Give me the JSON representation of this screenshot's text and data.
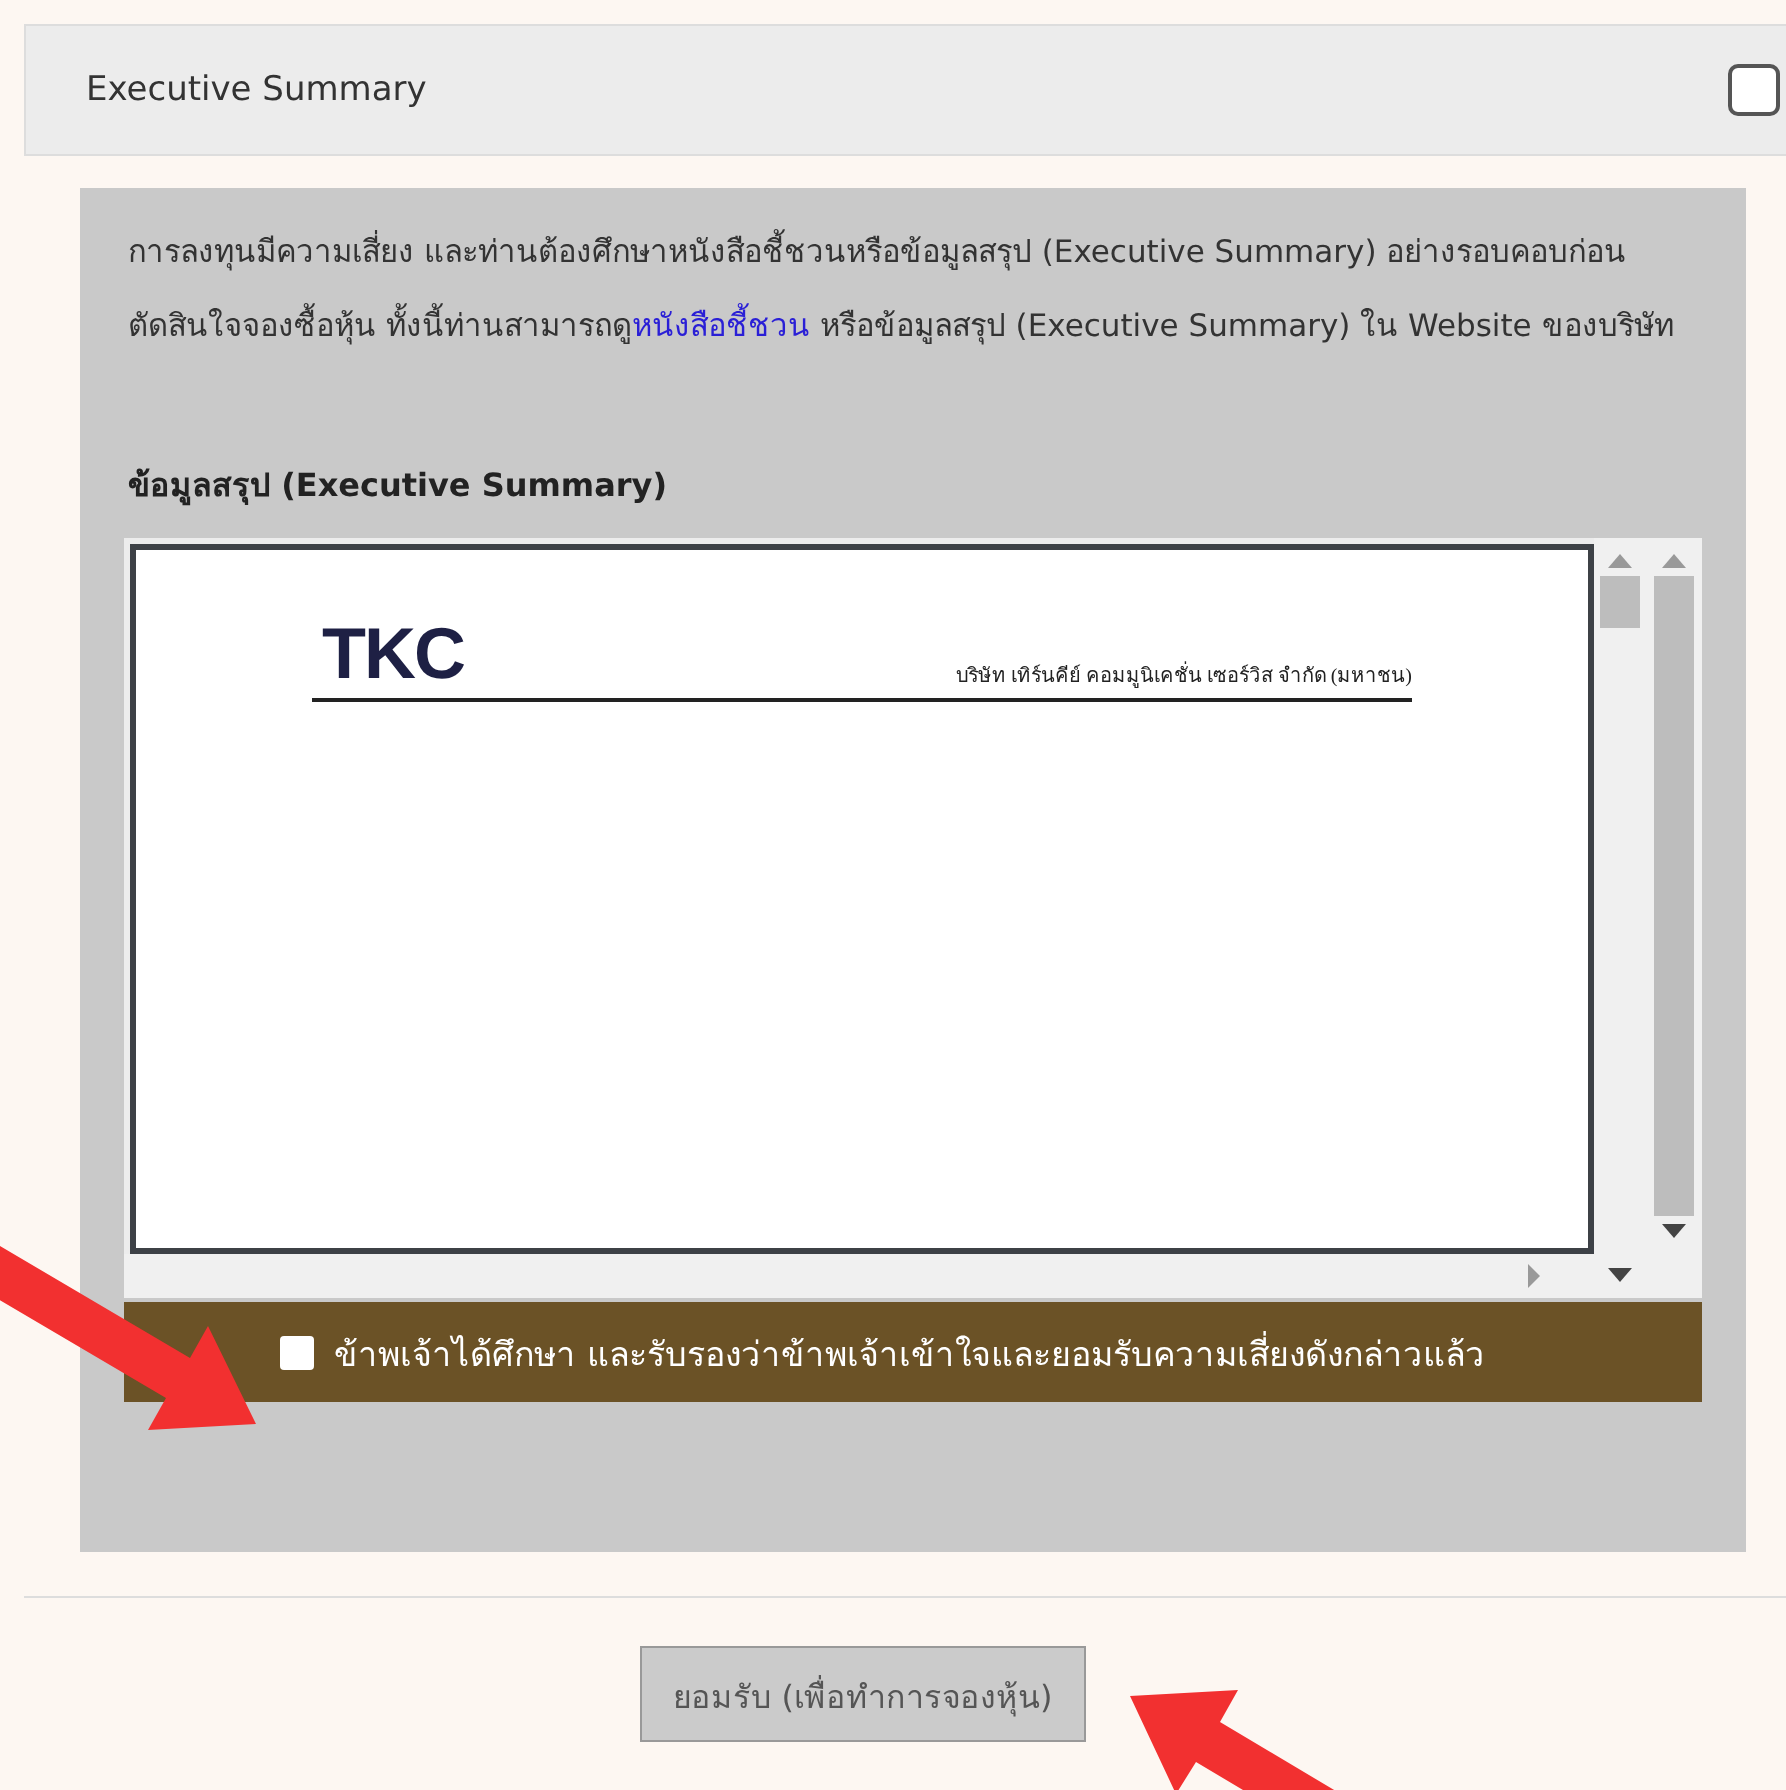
{
  "header": {
    "title": "Executive Summary",
    "checked": false
  },
  "intro": {
    "before": "การลงทุนมีความเสี่ยง และท่านต้องศึกษาหนังสือชี้ชวนหรือข้อมูลสรุป (Executive Summary) อย่างรอบคอบก่อนตัดสินใจจองซื้อหุ้น ทั้งนี้ท่านสามารถดู",
    "link": "หนังสือชี้ชวน",
    "after": " หรือข้อมูลสรุป (Executive Summary) ใน Website ของบริษัท"
  },
  "section_title": "ข้อมูลสรุป (Executive Summary)",
  "document": {
    "logo": "TKC",
    "company": "บริษัท เทิร์นคีย์ คอมมูนิเคชั่น เซอร์วิส จำกัด (มหาชน)"
  },
  "consent": {
    "label": "ข้าพเจ้าได้ศึกษา และรับรองว่าข้าพเจ้าเข้าใจและยอมรับความเสี่ยงดังกล่าวแล้ว",
    "checked": false
  },
  "accept_button": "ยอมรับ (เพื่อทำการจองหุ้น)"
}
